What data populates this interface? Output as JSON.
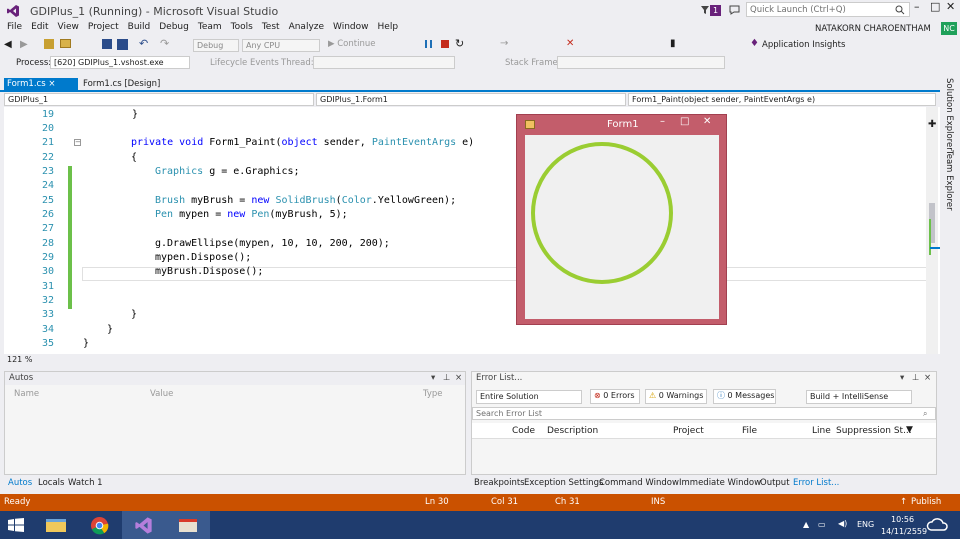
{
  "window": {
    "title": "GDIPlus_1 (Running) - Microsoft Visual Studio"
  },
  "titlebar": {
    "notif_count": "1",
    "quick_launch_placeholder": "Quick Launch (Ctrl+Q)",
    "user": "NATAKORN CHAROENTHAM",
    "avatar_initials": "NC"
  },
  "menu": [
    "File",
    "Edit",
    "View",
    "Project",
    "Build",
    "Debug",
    "Team",
    "Tools",
    "Test",
    "Analyze",
    "Window",
    "Help"
  ],
  "toolbar": {
    "config": "Debug",
    "platform": "Any CPU",
    "continue": "Continue",
    "app_insights": "Application Insights"
  },
  "toolbar2": {
    "process_label": "Process:",
    "process_value": "[620] GDIPlus_1.vshost.exe",
    "lifecycle": "Lifecycle Events",
    "thread_label": "Thread:",
    "stack_label": "Stack Frame:"
  },
  "tabs": {
    "active": "Form1.cs",
    "other": "Form1.cs [Design]"
  },
  "nav": {
    "project": "GDIPlus_1",
    "class": "GDIPlus_1.Form1",
    "member": "Form1_Paint(object sender, PaintEventArgs e)"
  },
  "code": {
    "line_numbers": [
      "19",
      "20",
      "21",
      "22",
      "23",
      "24",
      "25",
      "26",
      "27",
      "28",
      "29",
      "30",
      "31",
      "32",
      "33",
      "34",
      "35"
    ],
    "l19": "}",
    "l21_kw": "private void",
    "l21_name": " Form1_Paint(",
    "l21_kw2": "object",
    "l21_mid": " sender, ",
    "l21_ty": "PaintEventArgs",
    "l21_end": " e)",
    "l22": "{",
    "l23_ty": "Graphics",
    "l23_rest": " g = e.Graphics;",
    "l25_ty": "Brush",
    "l25_a": " myBrush = ",
    "l25_kw": "new",
    "l25_sp": " ",
    "l25_ty2": "SolidBrush",
    "l25_b": "(",
    "l25_ty3": "Color",
    "l25_c": ".YellowGreen);",
    "l26_ty": "Pen",
    "l26_a": " mypen = ",
    "l26_kw": "new",
    "l26_sp": " ",
    "l26_ty2": "Pen",
    "l26_b": "(myBrush, 5);",
    "l28": "g.DrawEllipse(mypen, 10, 10, 200, 200);",
    "l29": "mypen.Dispose();",
    "l30": "myBrush.Dispose();",
    "l33": "}",
    "l34": "}",
    "l35": "}"
  },
  "zoom": "121 %",
  "form1": {
    "title": "Form1",
    "ellipse_color": "#9acd32"
  },
  "autos": {
    "title": "Autos",
    "col_name": "Name",
    "col_value": "Value",
    "col_type": "Type"
  },
  "autos_tabs": [
    "Autos",
    "Locals",
    "Watch 1"
  ],
  "errors": {
    "title": "Error List...",
    "scope": "Entire Solution",
    "errors": "0 Errors",
    "warnings": "0 Warnings",
    "messages": "0 Messages",
    "filter": "Build + IntelliSense",
    "search_placeholder": "Search Error List",
    "cols": [
      "Code",
      "Description",
      "Project",
      "File",
      "Line",
      "Suppression St..."
    ]
  },
  "bottom_tabs": [
    "Breakpoints",
    "Exception Settings",
    "Command Window",
    "Immediate Window",
    "Output",
    "Error List..."
  ],
  "status": {
    "state": "Ready",
    "ln": "Ln 30",
    "col": "Col 31",
    "ch": "Ch 31",
    "ins": "INS",
    "publish": "Publish"
  },
  "side_tabs": [
    "Solution Explorer",
    "Team Explorer"
  ],
  "taskbar": {
    "lang": "ENG",
    "time": "10:56",
    "date": "14/11/2559"
  },
  "colors": {
    "accent": "#007acc",
    "status": "#ca5100",
    "form_title": "#c35d6b"
  }
}
